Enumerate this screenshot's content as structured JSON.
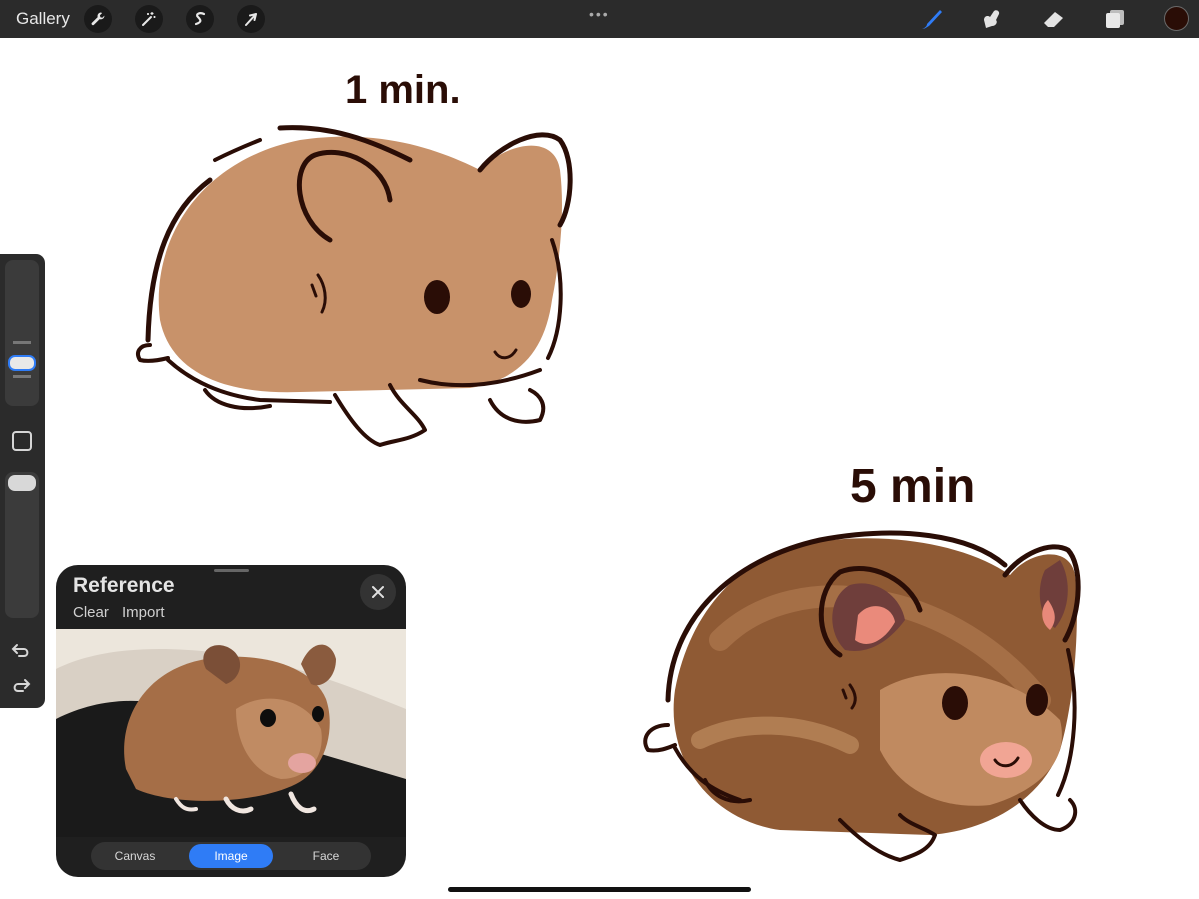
{
  "topbar": {
    "gallery_label": "Gallery",
    "left_tools": [
      "wrench-icon",
      "magic-wand-icon",
      "selection-s-icon",
      "transform-arrow-icon"
    ],
    "more_menu": "•••",
    "right_tools": [
      "brush-icon",
      "smudge-icon",
      "eraser-icon",
      "layers-icon"
    ],
    "current_color": "#2a0d06",
    "active_tool_color": "#2f7cf6"
  },
  "canvas": {
    "labels": [
      "1 min.",
      "5 min"
    ]
  },
  "sidebar": {
    "icons": [
      "brush-size-slider",
      "modify-square-icon",
      "opacity-slider",
      "undo-icon",
      "redo-icon"
    ]
  },
  "reference": {
    "title": "Reference",
    "clear_label": "Clear",
    "import_label": "Import",
    "close_icon": "close-icon",
    "tabs": [
      {
        "label": "Canvas",
        "active": false
      },
      {
        "label": "Image",
        "active": true
      },
      {
        "label": "Face",
        "active": false
      }
    ]
  }
}
